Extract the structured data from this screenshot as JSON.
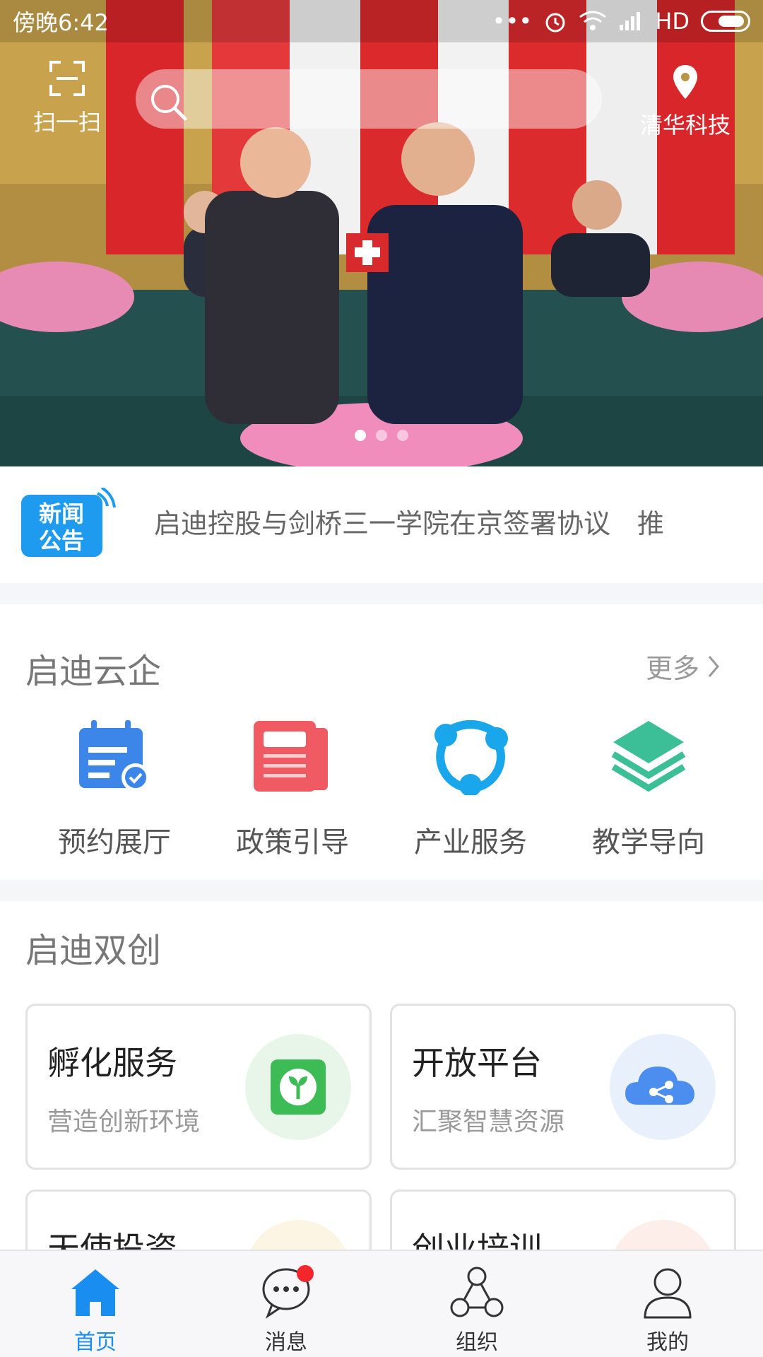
{
  "status_bar": {
    "time": "傍晚6:42",
    "network": "HD"
  },
  "header": {
    "scan_label": "扫一扫",
    "location_label": "清华科技"
  },
  "carousel": {
    "slide_count": 3,
    "active_index": 0
  },
  "news": {
    "badge_text_line1": "新闻",
    "badge_text_line2": "公告",
    "headline": "启迪控股与剑桥三一学院在京签署协议　推"
  },
  "section_cloud": {
    "title": "启迪云企",
    "more_label": "更多",
    "items": [
      {
        "label": "预约展厅",
        "icon": "calendar-check-icon",
        "color": "#3b86e8"
      },
      {
        "label": "政策引导",
        "icon": "document-icon",
        "color": "#ef5a63"
      },
      {
        "label": "产业服务",
        "icon": "share-network-icon",
        "color": "#1aa6ea"
      },
      {
        "label": "教学导向",
        "icon": "layers-icon",
        "color": "#3cbf97"
      }
    ]
  },
  "section_startup": {
    "title": "启迪双创",
    "cards": [
      {
        "title": "孵化服务",
        "subtitle": "营造创新环境",
        "icon": "sprout-icon",
        "color": "#3dbb55"
      },
      {
        "title": "开放平台",
        "subtitle": "汇聚智慧资源",
        "icon": "cloud-share-icon",
        "color": "#4b8ef0"
      },
      {
        "title": "天使投资",
        "subtitle": "",
        "icon": "investment-icon",
        "color": "#f2b23a"
      },
      {
        "title": "创业培训",
        "subtitle": "",
        "icon": "training-icon",
        "color": "#f06a4a"
      }
    ]
  },
  "tabbar": {
    "tabs": [
      {
        "label": "首页",
        "icon": "home-icon",
        "active": true
      },
      {
        "label": "消息",
        "icon": "message-icon",
        "badge": true
      },
      {
        "label": "组织",
        "icon": "organization-icon"
      },
      {
        "label": "我的",
        "icon": "profile-icon"
      }
    ],
    "active_color": "#1a8df0"
  }
}
